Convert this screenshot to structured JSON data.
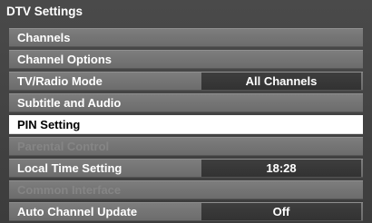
{
  "title": "DTV Settings",
  "menu": {
    "channels": "Channels",
    "channel_options": "Channel Options",
    "tv_radio_mode": {
      "label": "TV/Radio Mode",
      "value": "All Channels"
    },
    "subtitle_audio": "Subtitle and Audio",
    "pin_setting": "PIN Setting",
    "parental_control": "Parental Control",
    "local_time": {
      "label": "Local Time Setting",
      "value": "18:28"
    },
    "common_interface": "Common Interface",
    "auto_channel_update": {
      "label": "Auto Channel Update",
      "value": "Off"
    }
  },
  "colors": {
    "panel": "#444444",
    "row": "#777777",
    "selected_row": "#ffffff",
    "value_box": "#383838",
    "disabled_text": "#858585"
  }
}
